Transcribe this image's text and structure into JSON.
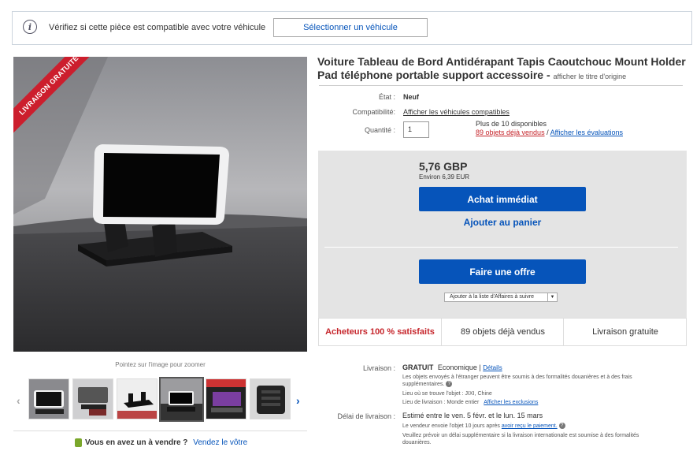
{
  "compat": {
    "message": "Vérifiez si cette pièce est compatible avec votre véhicule",
    "button": "Sélectionner un véhicule"
  },
  "gallery": {
    "ribbon": "LIVRAISON GRATUITE",
    "zoom_hint": "Pointez sur l'image pour zoomer",
    "thumbnails": 6,
    "selected_thumbnail": 4
  },
  "sell": {
    "question": "Vous en avez un à vendre ?",
    "link": "Vendez le vôtre"
  },
  "item": {
    "title": "Voiture Tableau de Bord Antidérapant Tapis Caoutchouc Mount Holder Pad téléphone portable support accessoire",
    "title_sep": " - ",
    "original_title_link": "afficher le titre d'origine",
    "condition_label": "État :",
    "condition": "Neuf",
    "compat_label": "Compatibilité:",
    "compat_link": "Afficher les véhicules compatibles",
    "qty_label": "Quantité :",
    "qty_value": "1",
    "available": "Plus de 10 disponibles",
    "sold_link": "89 objets déjà vendus",
    "slash": " / ",
    "reviews_link": "Afficher les évaluations"
  },
  "buy": {
    "price": "5,76 GBP",
    "approx": "Environ 6,39 EUR",
    "buy_now": "Achat immédiat",
    "add_cart": "Ajouter au panier",
    "make_offer": "Faire une offre",
    "watch": "Ajouter à la liste d'Affaires à suivre"
  },
  "stats": {
    "satisfied": "Acheteurs 100 % satisfaits",
    "sold": "89 objets déjà vendus",
    "free_ship": "Livraison gratuite"
  },
  "shipping": {
    "label": "Livraison :",
    "cost": "GRATUIT",
    "method": "Economique",
    "pipe": " | ",
    "details": "Détails",
    "note": "Les objets envoyés à l'étranger peuvent être soumis à des formalités douanières et à des frais supplémentaires.",
    "location": "Lieu où se trouve l'objet : JIXI, Chine",
    "delivery_area": "Lieu de livraison : Monde entier",
    "exclusions": "Afficher les exclusions",
    "delay_label": "Délai de livraison :",
    "estimate": "Estimé entre le ven. 5 févr. et le lun. 15 mars",
    "dispatch": "Le vendeur envoie l'objet 10 jours après",
    "dispatch_link": "avoir reçu le paiement.",
    "intl_note": "Veuillez prévoir un délai supplémentaire si la livraison internationale est soumise à des formalités douanières."
  },
  "colors": {
    "link": "#0654ba",
    "button": "#0654ba",
    "ribbon": "#cc1e2d",
    "sold_red": "#c6252b"
  }
}
